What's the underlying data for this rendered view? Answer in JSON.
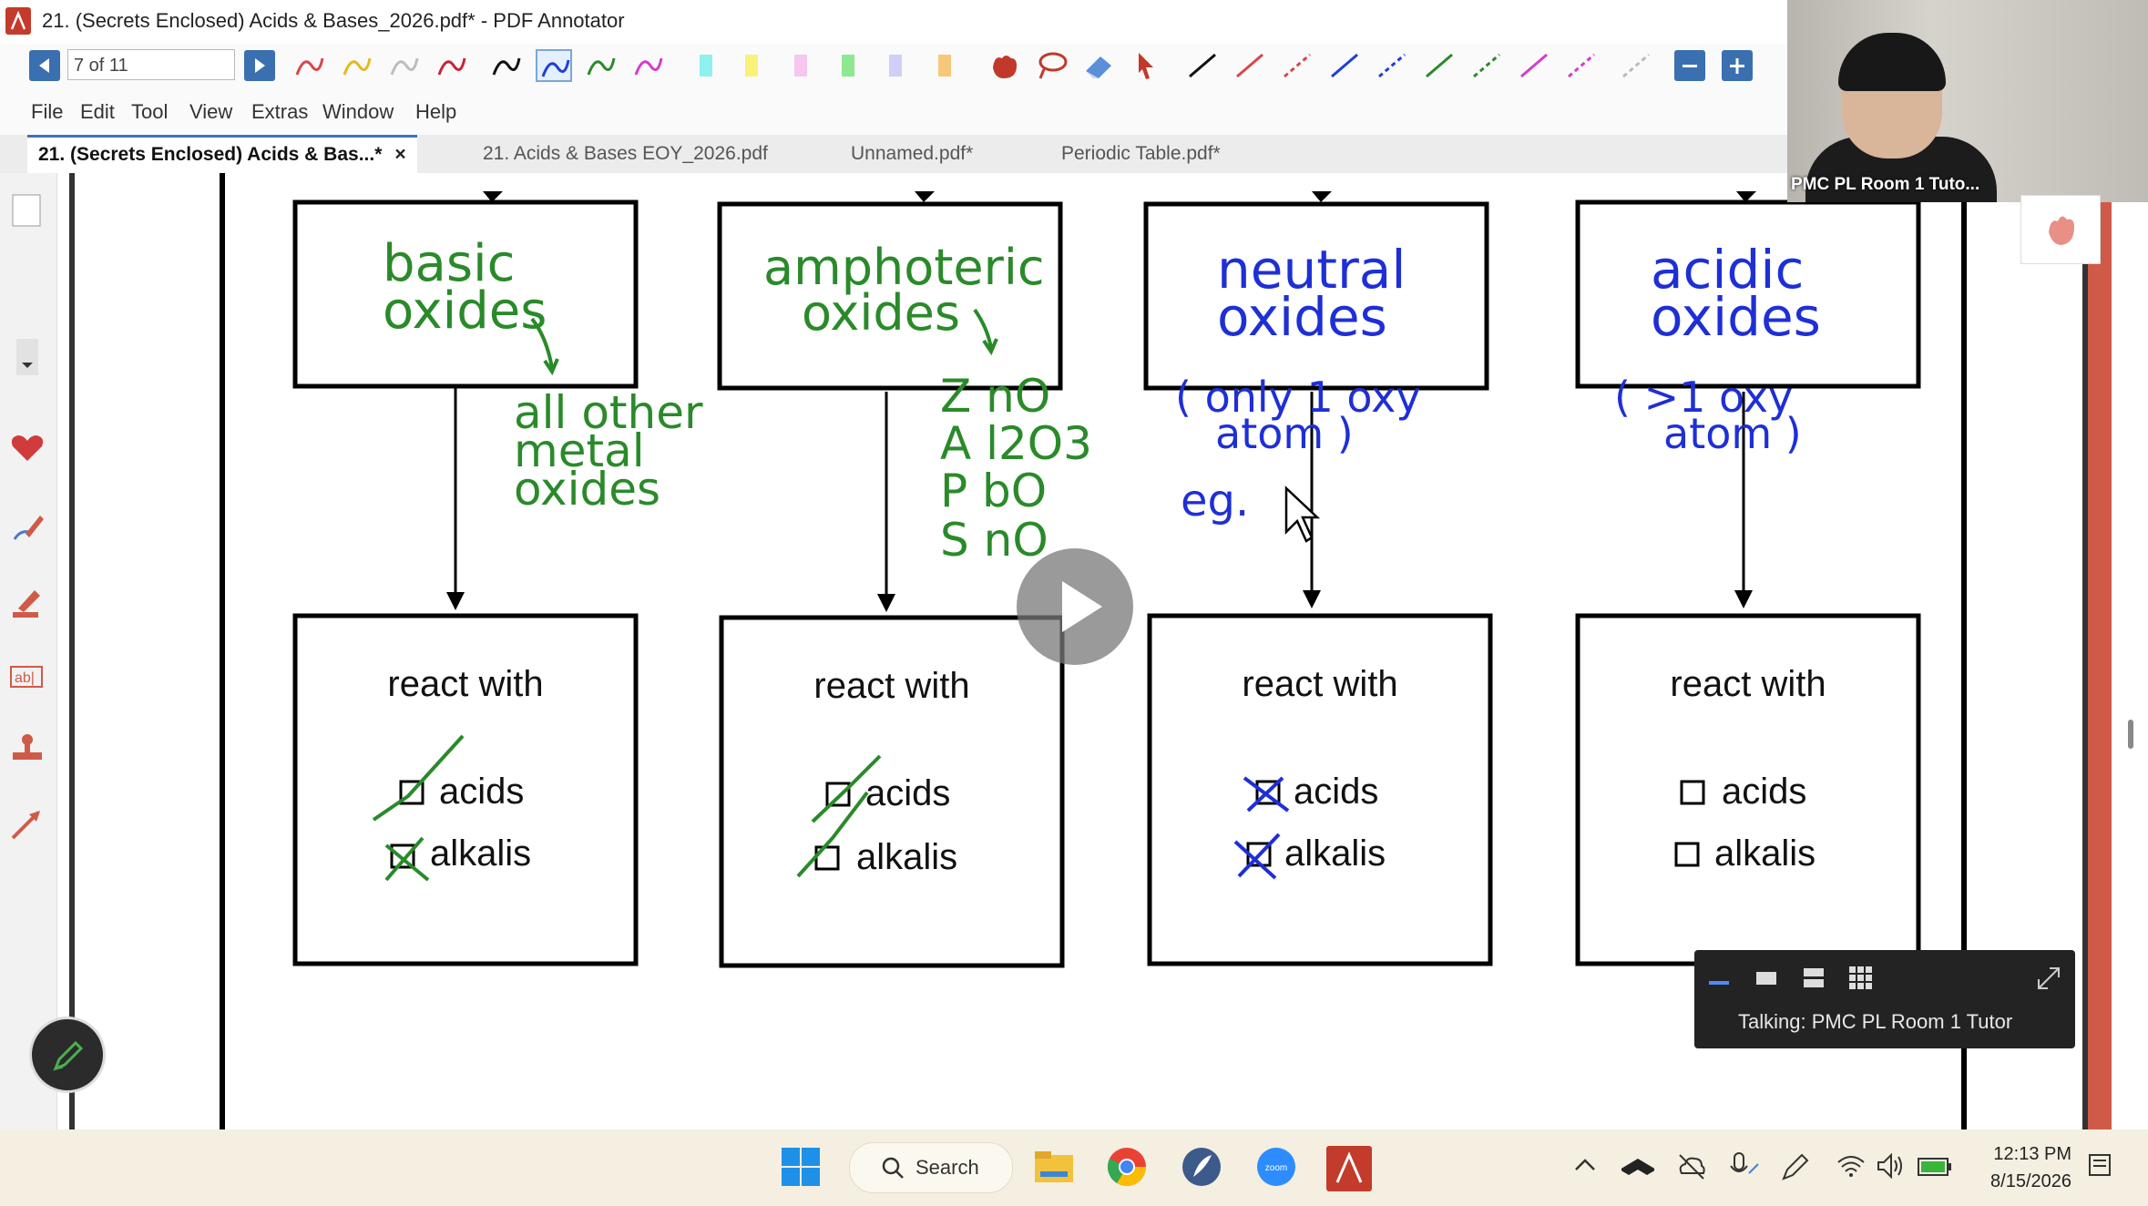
{
  "window": {
    "title": "21. (Secrets Enclosed) Acids & Bases_2026.pdf* - PDF Annotator"
  },
  "toolbar": {
    "page_indicator": "7 of 11"
  },
  "menu": [
    "File",
    "Edit",
    "Tool",
    "View",
    "Extras",
    "Window",
    "Help"
  ],
  "tabs": [
    {
      "label": "21. (Secrets Enclosed) Acids & Bas...*",
      "active": true,
      "close": "×"
    },
    {
      "label": "21. Acids & Bases EOY_2026.pdf",
      "active": false
    },
    {
      "label": "Unnamed.pdf*",
      "active": false
    },
    {
      "label": "Periodic Table.pdf*",
      "active": false
    }
  ],
  "diagram": {
    "top_boxes": [
      {
        "label_lines": [
          "basic",
          "oxides"
        ],
        "color": "#2a8a2a"
      },
      {
        "label_lines": [
          "amphoteric",
          "oxides"
        ],
        "color": "#2a8a2a"
      },
      {
        "label_lines": [
          "neutral",
          "oxides"
        ],
        "color": "#1f2fd6"
      },
      {
        "label_lines": [
          "acidic",
          "oxides"
        ],
        "color": "#1f2fd6"
      }
    ],
    "handwritten_notes": {
      "basic": [
        "all other",
        "metal",
        "oxides"
      ],
      "amphoteric": [
        "Z nO",
        "A l2O3",
        "P bO",
        "S nO"
      ],
      "neutral": [
        "( only 1 oxy",
        "atom )",
        "eg."
      ],
      "acidic": [
        "( >1 oxy",
        "atom )"
      ]
    },
    "bottom_boxes": [
      {
        "title": "react with",
        "options": [
          "acids",
          "alkalis"
        ],
        "marks": [
          "check",
          "cross"
        ],
        "mark_color": "#2a8a2a"
      },
      {
        "title": "react with",
        "options": [
          "acids",
          "alkalis"
        ],
        "marks": [
          "check",
          "check"
        ],
        "mark_color": "#2a8a2a"
      },
      {
        "title": "react with",
        "options": [
          "acids",
          "alkalis"
        ],
        "marks": [
          "cross",
          "cross"
        ],
        "mark_color": "#1f2fd6"
      },
      {
        "title": "react with",
        "options": [
          "acids",
          "alkalis"
        ],
        "marks": [
          "none",
          "none"
        ],
        "mark_color": "#000000"
      }
    ]
  },
  "video": {
    "participant": "PMC PL Room 1 Tuto..."
  },
  "zoom_panel": {
    "talking": "Talking: PMC PL Room 1 Tutor"
  },
  "taskbar": {
    "search_label": "Search",
    "time": "12:13 PM",
    "date": "8/15/2026"
  }
}
